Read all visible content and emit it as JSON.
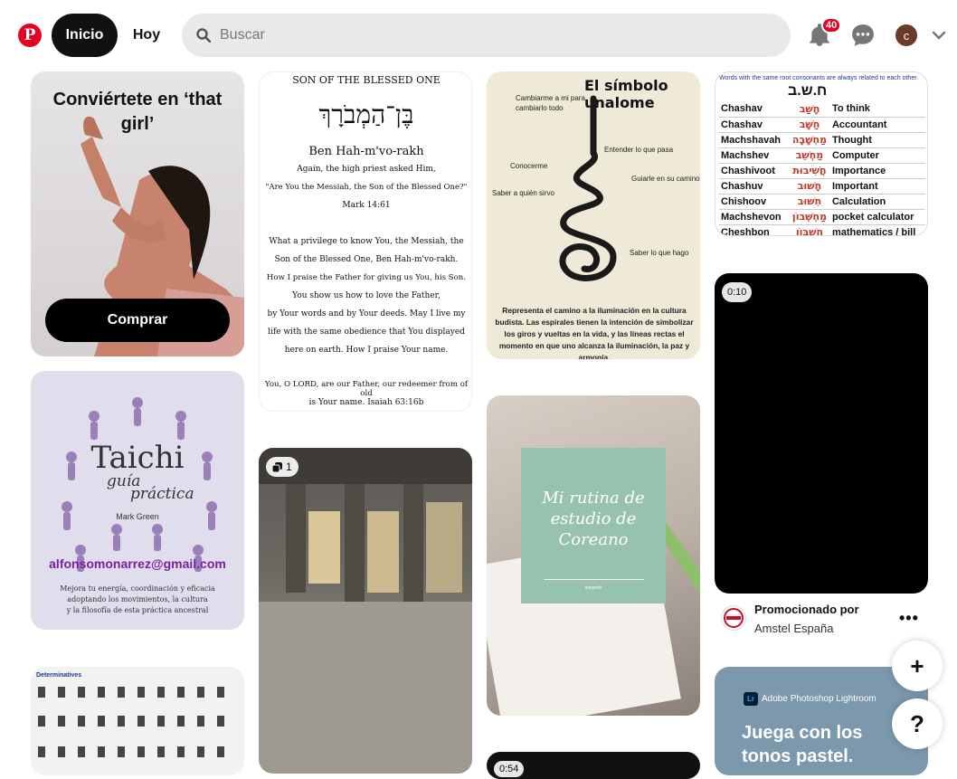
{
  "header": {
    "logo": "P",
    "nav_home": "Inicio",
    "nav_today": "Hoy",
    "search_placeholder": "Buscar",
    "notification_count": "40",
    "avatar_initial": "c"
  },
  "pins": {
    "that_girl": {
      "title": "Conviértete en ‘that girl’",
      "button": "Comprar"
    },
    "blessed": {
      "heading": "SON OF THE BLESSED ONE",
      "hebrew": "בֶּן־הַמְבֹרָךְ",
      "translit": "Ben Hah-m'vo-rakh",
      "l1": "Again, the high priest asked Him,",
      "l2": "\"Are You the Messiah, the Son of the Blessed One?\"",
      "ref1": "Mark 14:61",
      "p1": "What a privilege to know You, the Messiah, the",
      "p2": "Son of the Blessed One, Ben Hah-m'vo-rakh.",
      "p3": "How I praise the Father for giving us You, his Son.",
      "p4": "You show us how to love the Father,",
      "p5": "by Your words and by Your deeds. May I live my",
      "p6": "life with the same obedience that You displayed",
      "p7": "here on earth. How I praise Your name.",
      "q1": "You, O LORD, are our Father, our redeemer from of old",
      "q2": "is Your name.  Isaiah 63:16b"
    },
    "unalome": {
      "title": "El símbolo unalome",
      "a": "Cambiarme a mi para cambiarlo todo",
      "b": "Entender lo que pasa",
      "c": "Conocerme",
      "d": "Guiarle en su camino",
      "e": "Saber a quién sirvo",
      "f": "Saber lo que hago",
      "caption": "Representa el camino a la iluminación en la cultura budista. Las espirales tienen la intención de simbolizar los giros y vueltas en la vida, y las líneas rectas el momento en que uno alcanza la iluminación, la paz y armonía."
    },
    "hebrew_words": {
      "note": "Words with the same root consonants are always related to each other.",
      "root": "ח.ש.ב",
      "rows": [
        [
          "Chashav",
          "חָשַׁב",
          "To think"
        ],
        [
          "Chashav",
          "חַשָּׁב",
          "Accountant"
        ],
        [
          "Machshavah",
          "מַחְשָׁבָה",
          "Thought"
        ],
        [
          "Machshev",
          "מַחְשֵׁב",
          "Computer"
        ],
        [
          "Chashivoot",
          "חֲשִׁיבוּת",
          "Importance"
        ],
        [
          "Chashuv",
          "חָשׁוּב",
          "Important"
        ],
        [
          "Chishoov",
          "חִשּׁוּב",
          "Calculation"
        ],
        [
          "Machshevon",
          "מַחְשְׁבוֹן",
          "pocket calculator"
        ],
        [
          "Cheshbon",
          "חֶשְׁבּוֹן",
          "mathematics / bill"
        ]
      ]
    },
    "video": {
      "duration": "0:10"
    },
    "promo": {
      "line1": "Promocionado por",
      "line2": "Amstel España",
      "more": "•••"
    },
    "taichi": {
      "title": "Taichi",
      "subtitle1": "guía",
      "subtitle2": "práctica",
      "author": "Mark Green",
      "email": "alfonsomonarrez@gmail.com",
      "d1": "Mejora tu energía, coordinación y eficacia",
      "d2": "adoptando los movimientos, la cultura",
      "d3": "y la filosofía de esta práctica ancestral"
    },
    "determinatives": {
      "title": "Determinatives"
    },
    "rain": {
      "count": "1"
    },
    "korean": {
      "title": "Mi rutina de estudio de Coreano",
      "small": "sooyeok"
    },
    "video2": {
      "duration": "0:54"
    },
    "lightroom": {
      "app": "Adobe Photoshop Lightroom",
      "badge": "Lr",
      "headline": "Juega con los tonos pastel."
    }
  },
  "fab": {
    "add": "+",
    "help": "?"
  }
}
